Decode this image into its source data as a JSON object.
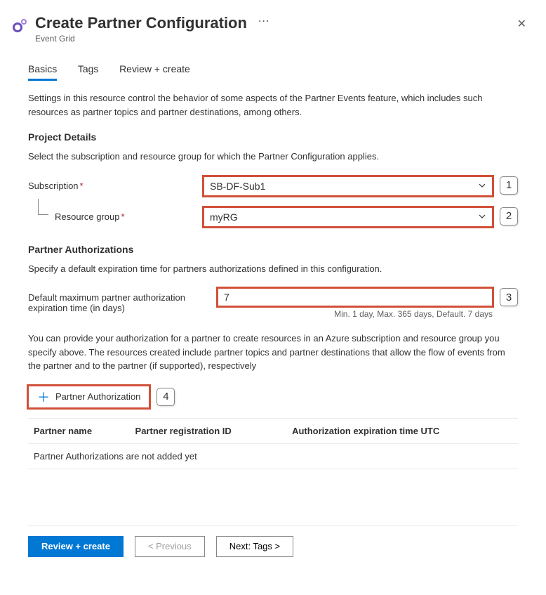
{
  "header": {
    "title": "Create Partner Configuration",
    "subtitle": "Event Grid"
  },
  "tabs": [
    "Basics",
    "Tags",
    "Review + create"
  ],
  "intro": "Settings in this resource control the behavior of some aspects of the Partner Events feature, which includes such resources as partner topics and partner destinations, among others.",
  "project": {
    "heading": "Project Details",
    "desc": "Select the subscription and resource group for which the Partner Configuration applies.",
    "subscription_label": "Subscription",
    "subscription_value": "SB-DF-Sub1",
    "rg_label": "Resource group",
    "rg_value": "myRG"
  },
  "auth": {
    "heading": "Partner Authorizations",
    "desc": "Specify a default expiration time for partners authorizations defined in this configuration.",
    "exp_label": "Default maximum partner authorization expiration time (in days)",
    "exp_value": "7",
    "exp_helper": "Min. 1 day, Max. 365 days, Default. 7 days",
    "desc2": "You can provide your authorization for a partner to create resources in an Azure subscription and resource group you specify above. The resources created include partner topics and partner destinations that allow the flow of events from the partner and to the partner (if supported), respectively",
    "add_label": "Partner Authorization",
    "col1": "Partner name",
    "col2": "Partner registration ID",
    "col3": "Authorization expiration time UTC",
    "empty": "Partner Authorizations are not added yet"
  },
  "callouts": {
    "c1": "1",
    "c2": "2",
    "c3": "3",
    "c4": "4"
  },
  "footer": {
    "review": "Review + create",
    "prev": "< Previous",
    "next": "Next: Tags >"
  }
}
